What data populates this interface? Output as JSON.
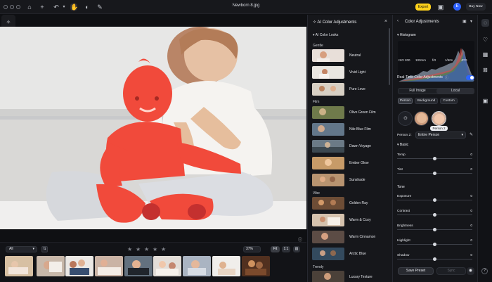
{
  "window": {
    "title": "Newborn 8.jpg",
    "export": "Export",
    "avatar": "E",
    "buy": "Buy Now"
  },
  "icons": {
    "home": "home-icon",
    "add": "plus-icon",
    "undo": "undo-icon",
    "hand": "hand-icon",
    "mask": "mask-icon",
    "brush": "brush-icon",
    "filmstrip": "compare-icon"
  },
  "canvas": {
    "subject": "Baby girl and mother on sofa with red selection overlay",
    "selection_color": "#f14a3b"
  },
  "bottom": {
    "filter": "All",
    "zoom": "37%",
    "fit": "Fit",
    "one": "1:1",
    "stars": [
      "★",
      "★",
      "★",
      "★",
      "★"
    ]
  },
  "presets": {
    "panel_title": "AI Color Adjustments",
    "section": "AI Color Looks",
    "groups": [
      "Gentle",
      "Film",
      "Vibe",
      "Trendy"
    ],
    "items": [
      {
        "label": "Neutral",
        "group": "Gentle"
      },
      {
        "label": "Vivid Light",
        "group": "Gentle"
      },
      {
        "label": "Pure Love",
        "group": "Gentle"
      },
      {
        "label": "Olive Green Film",
        "group": "Film"
      },
      {
        "label": "Nile Blue Film",
        "group": "Film"
      },
      {
        "label": "Dawn Voyage",
        "group": "Film"
      },
      {
        "label": "Ember Glow",
        "group": "Film"
      },
      {
        "label": "Sunshade",
        "group": "Film"
      },
      {
        "label": "Golden Ray",
        "group": "Vibe"
      },
      {
        "label": "Warm & Cozy",
        "group": "Vibe"
      },
      {
        "label": "Warm Cinnamon",
        "group": "Vibe"
      },
      {
        "label": "Arctic Blue",
        "group": "Vibe"
      },
      {
        "label": "Luxury Texture",
        "group": "Trendy"
      }
    ]
  },
  "right": {
    "title": "Color Adjustments",
    "histogram": "Histogram",
    "exif": [
      "ISO 200",
      "103mm",
      "f/3",
      "1/50s",
      "JPG"
    ],
    "realtime": "Real-Time Color Adjustments",
    "segments": [
      "Full Image",
      "Local"
    ],
    "chips": [
      "Person",
      "Background",
      "Custom"
    ],
    "person_label": "Person 2",
    "person_row": "Person 2:",
    "entire": "Entire Person",
    "basic": "Basic",
    "tone": "Tone",
    "sliders": [
      {
        "label": "Temp",
        "value": "0",
        "percent": 50
      },
      {
        "label": "Tint",
        "value": "0",
        "percent": 50
      },
      {
        "label": "Exposure",
        "value": "0",
        "percent": 50
      },
      {
        "label": "Contrast",
        "value": "0",
        "percent": 50
      },
      {
        "label": "Brightness",
        "value": "0",
        "percent": 50
      },
      {
        "label": "Highlight",
        "value": "0",
        "percent": 50
      },
      {
        "label": "Shadow",
        "value": "0",
        "percent": 50
      }
    ],
    "save": "Save Preset",
    "sync": "Sync"
  },
  "rail": {
    "items": [
      "chat-icon",
      "heart-icon",
      "grid-icon",
      "select-icon",
      "camera-icon"
    ],
    "help": "?"
  }
}
